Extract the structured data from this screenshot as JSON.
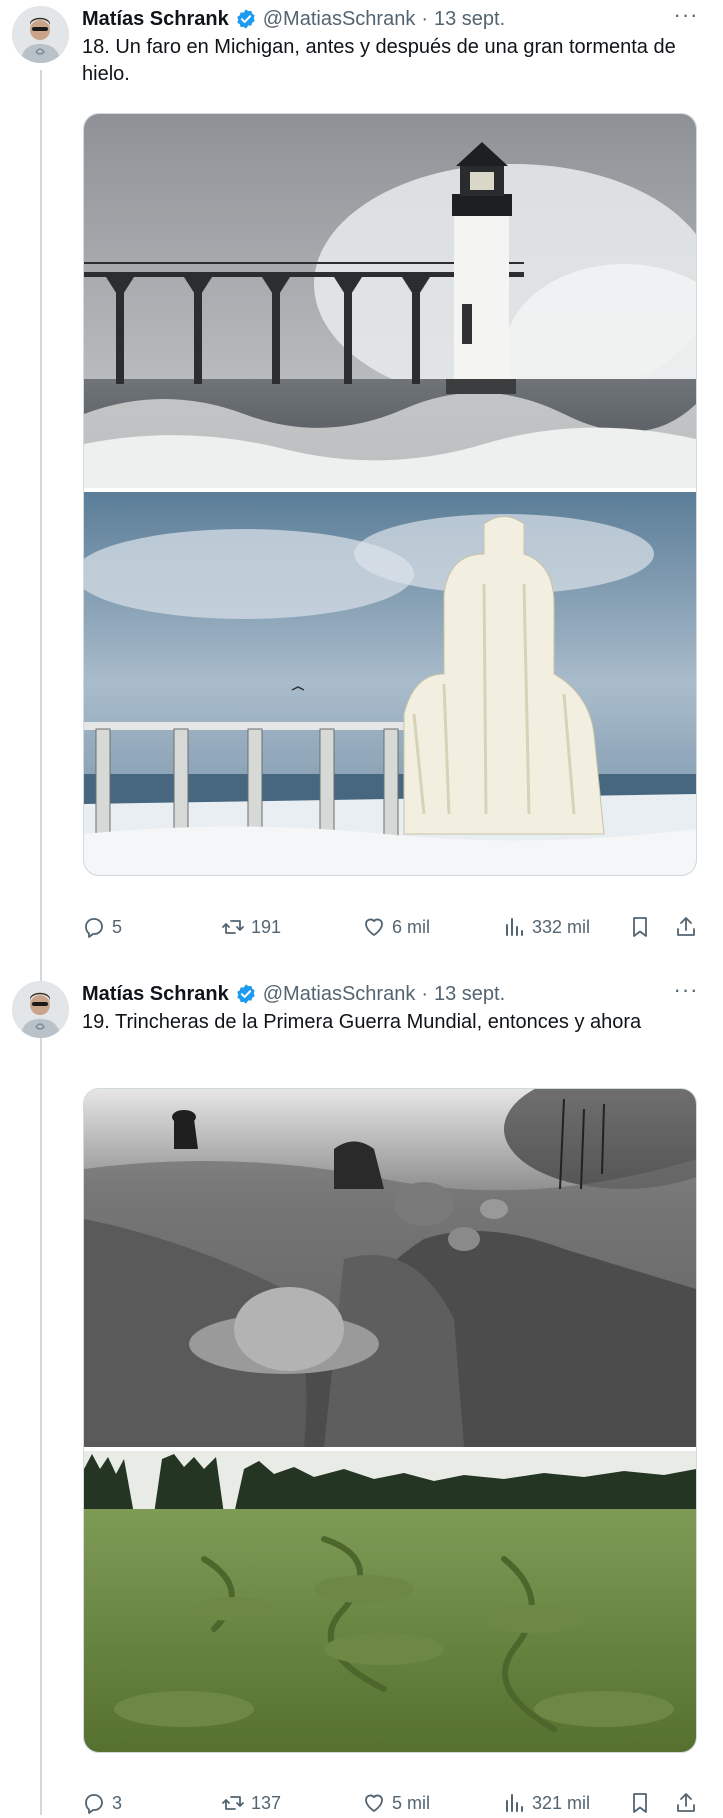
{
  "tweets": [
    {
      "author": "Matías Schrank",
      "handle": "@MatiasSchrank",
      "separator": "·",
      "date": "13 sept.",
      "more": "···",
      "text": "18. Un faro en Michigan, antes y después de una gran tormenta de hielo.",
      "media": [
        "lighthouse-storm-photo",
        "frozen-lighthouse-photo"
      ],
      "stats": {
        "replies": "5",
        "retweets": "191",
        "likes": "6 mil",
        "views": "332 mil"
      }
    },
    {
      "author": "Matías Schrank",
      "handle": "@MatiasSchrank",
      "separator": "·",
      "date": "13 sept.",
      "more": "···",
      "text": "19. Trincheras de la Primera Guerra Mundial, entonces y ahora",
      "media": [
        "ww1-trenches-photo",
        "trenches-today-photo"
      ],
      "stats": {
        "replies": "3",
        "retweets": "137",
        "likes": "5 mil",
        "views": "321 mil"
      }
    }
  ],
  "icons": [
    "reply-icon",
    "retweet-icon",
    "like-icon",
    "views-icon",
    "bookmark-icon",
    "share-icon",
    "verified-badge-icon",
    "more-icon"
  ],
  "colors": {
    "text": "#0f1419",
    "secondary": "#536471",
    "verified": "#1d9bf0",
    "border": "#cfd9de"
  }
}
